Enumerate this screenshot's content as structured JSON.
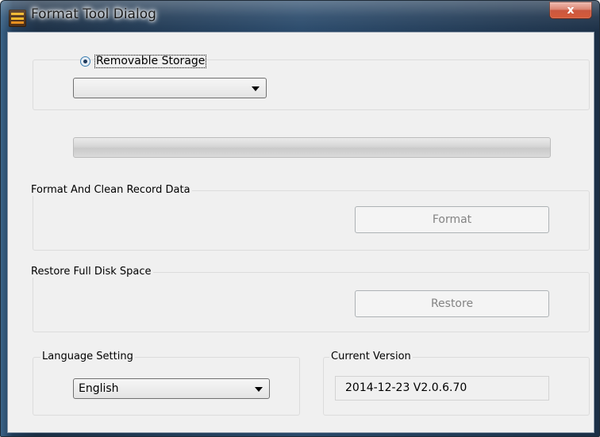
{
  "window": {
    "title": "Format Tool Dialog",
    "close_glyph": "x",
    "app_icon": "tool-app-icon"
  },
  "storage": {
    "radio_label": "Removable Storage",
    "radio_selected": true,
    "drive_value": ""
  },
  "progress": {
    "value_percent": 0
  },
  "format_group": {
    "title": "Format And Clean Record Data",
    "button_label": "Format",
    "button_enabled": false
  },
  "restore_group": {
    "title": "Restore Full Disk Space",
    "button_label": "Restore",
    "button_enabled": false
  },
  "language": {
    "title": "Language Setting",
    "selected": "English"
  },
  "version": {
    "title": "Current Version",
    "value": "2014-12-23 V2.0.6.70"
  },
  "colors": {
    "title_bar": "#1f3a57",
    "close_button": "#c1381c",
    "dialog_bg": "#f0f0f0",
    "disabled_text": "#838383"
  }
}
